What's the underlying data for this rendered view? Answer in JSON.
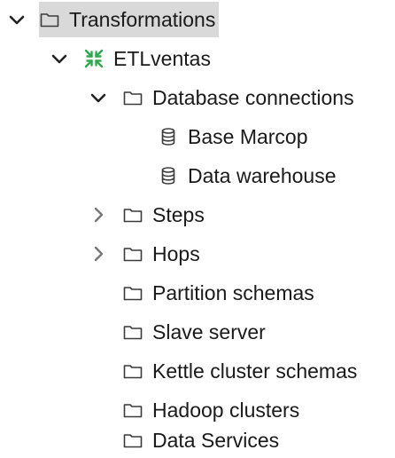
{
  "colors": {
    "selection": "#d9d9d9",
    "text": "#1a1a1a",
    "icon_stroke": "#3a3a3a",
    "chevron": "#222222",
    "chevron_collapsed": "#777777",
    "transformation_icon": "#2fa84f"
  },
  "tree": {
    "root": {
      "label": "Transformations",
      "icon": "folder-icon",
      "expanded": true,
      "selected": true
    },
    "transformation": {
      "label": "ETLventas",
      "icon": "transformation-icon",
      "expanded": true
    },
    "database_connections": {
      "label": "Database connections",
      "icon": "folder-icon",
      "expanded": true,
      "items": [
        {
          "label": "Base Marcop",
          "icon": "database-icon"
        },
        {
          "label": "Data warehouse",
          "icon": "database-icon"
        }
      ]
    },
    "steps": {
      "label": "Steps",
      "icon": "folder-icon",
      "expanded": false
    },
    "hops": {
      "label": "Hops",
      "icon": "folder-icon",
      "expanded": false
    },
    "partition_schemas": {
      "label": "Partition schemas",
      "icon": "folder-icon"
    },
    "slave_server": {
      "label": "Slave server",
      "icon": "folder-icon"
    },
    "kettle_cluster_schemas": {
      "label": "Kettle cluster schemas",
      "icon": "folder-icon"
    },
    "hadoop_clusters": {
      "label": "Hadoop clusters",
      "icon": "folder-icon"
    },
    "data_services": {
      "label": "Data Services",
      "icon": "folder-icon"
    }
  }
}
